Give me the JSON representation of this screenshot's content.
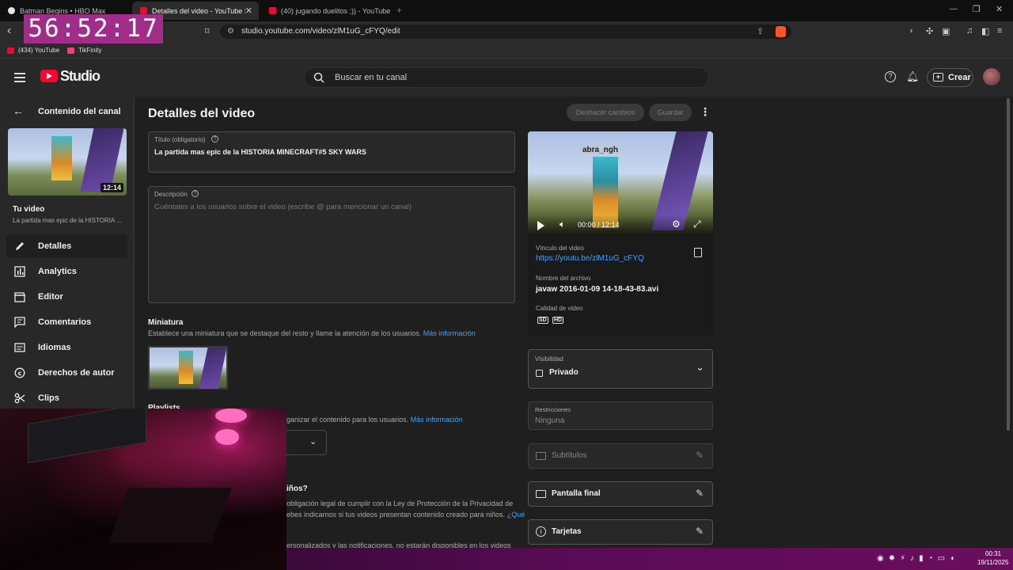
{
  "browser": {
    "tabs": [
      {
        "label": "Batman Begins • HBO Max",
        "favicon_color": "#e6e6e6"
      },
      {
        "label": "Detalles del video - YouTube Stu",
        "favicon_color": "#ff0033"
      },
      {
        "label": "(40) jugando duelitos ;)) - YouTube",
        "favicon_color": "#ff0033"
      }
    ],
    "url": "studio.youtube.com/video/zlM1uG_cFYQ/edit",
    "bookmarks": [
      {
        "label": "(434) YouTube",
        "color": "#ff0033"
      },
      {
        "label": "TikFinity",
        "color": "#ff3b7a"
      }
    ]
  },
  "timer": "56:52:17",
  "studio": {
    "logo_text": "Studio",
    "search_placeholder": "Buscar en tu canal",
    "create_label": "Crear"
  },
  "sidebar": {
    "back_label": "Contenido del canal",
    "thumb_duration": "12:14",
    "your_video_label": "Tu video",
    "video_title_short": "La partida mas epic de la HISTORIA ...",
    "items": [
      {
        "label": "Detalles",
        "icon": "pencil-icon"
      },
      {
        "label": "Analytics",
        "icon": "analytics-icon"
      },
      {
        "label": "Editor",
        "icon": "clapper-icon"
      },
      {
        "label": "Comentarios",
        "icon": "comment-icon"
      },
      {
        "label": "Idiomas",
        "icon": "subtitles-icon"
      },
      {
        "label": "Derechos de autor",
        "icon": "copyright-icon"
      },
      {
        "label": "Clips",
        "icon": "scissors-icon"
      }
    ]
  },
  "main": {
    "heading": "Detalles del video",
    "undo_label": "Deshacer cambios",
    "save_label": "Guardar",
    "title_field": {
      "label": "Título (obligatorio)",
      "value": "La partida mas epic de la HISTORIA MINECRAFT#5 SKY WARS"
    },
    "description_field": {
      "label": "Descripción",
      "placeholder": "Cuéntales a los usuarios sobre el video (escribe @ para mencionar un canal)"
    },
    "thumbnail": {
      "heading": "Miniatura",
      "text": "Establece una miniatura que se destaque del resto y llame la atención de los usuarios.",
      "link": "Más información"
    },
    "playlist": {
      "heading": "Playlists",
      "text_fragment": "ganizar el contenido para los usuarios.",
      "link": "Más información"
    },
    "audience": {
      "question_fragment": "iños?",
      "text_line1": "obligación legal de cumplir con la Ley de Protección de la Privacidad de",
      "text_line2": "ebes indicarnos si tus videos presentan contenido creado para niños.",
      "link_fragment": "¿Qué",
      "text_line3": "ersonalizados y las notificaciones, no estarán disponibles en los videos"
    }
  },
  "preview": {
    "player_time": "00:00 / 12:14",
    "overlay_name": "abra_ngh",
    "link_label": "Vínculo del video",
    "link_url": "https://youtu.be/zlM1uG_cFYQ",
    "filename_label": "Nombre del archivo",
    "filename": "javaw 2016-01-09 14-18-43-83.avi",
    "quality_label": "Calidad de video",
    "quality_badges": [
      "SD",
      "HD"
    ],
    "visibility_label": "Visibilidad",
    "visibility_value": "Privado",
    "restrictions_label": "Restricciones",
    "restrictions_value": "Ninguna",
    "subtitles_label": "Subtítulos",
    "endscreen_label": "Pantalla final",
    "cards_label": "Tarjetas"
  },
  "taskbar": {
    "time": "00:31",
    "date": "19/11/2025"
  },
  "colors": {
    "accent": "#3ea6ff",
    "timer_bg": "#a02d8a",
    "taskbar": "#5a0b55"
  }
}
